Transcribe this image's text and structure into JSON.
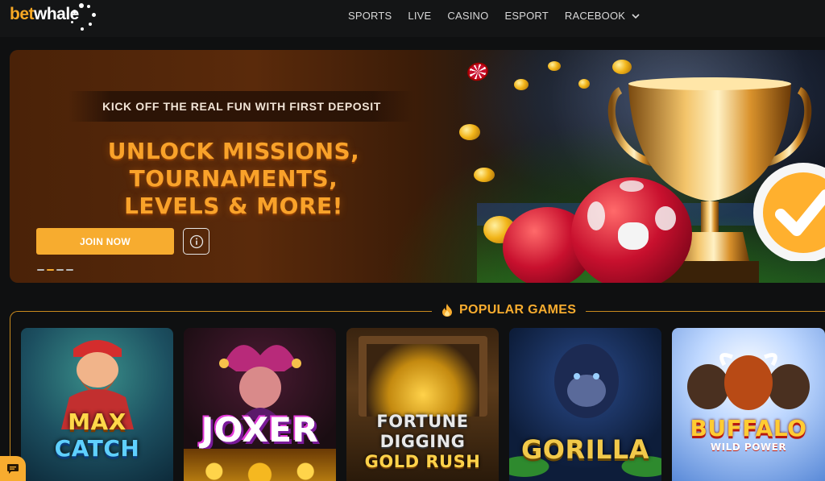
{
  "header": {
    "logo_part1": "bet",
    "logo_part2": "whale",
    "nav": [
      {
        "label": "SPORTS"
      },
      {
        "label": "LIVE"
      },
      {
        "label": "CASINO"
      },
      {
        "label": "ESPORT"
      },
      {
        "label": "RACEBOOK",
        "icon": "chevron-down-icon"
      }
    ]
  },
  "hero": {
    "tagline": "KICK OFF THE REAL FUN WITH FIRST DEPOSIT",
    "headline_line1": "UNLOCK MISSIONS, TOURNAMENTS,",
    "headline_line2": "LEVELS & MORE!",
    "cta_label": "JOIN NOW",
    "info_icon": "info-icon",
    "slides_total": 4,
    "active_slide": 2
  },
  "popular": {
    "title": "POPULAR GAMES",
    "icon": "fire-icon",
    "games": [
      {
        "title_line1": "MAX",
        "title_line2": "CATCH"
      },
      {
        "title_line1": "JOXER"
      },
      {
        "title_line1": "FORTUNE",
        "title_line2": "DIGGING",
        "title_line3": "GOLD RUSH"
      },
      {
        "title_line1": "GORILLA"
      },
      {
        "title_line1": "BUFFALO",
        "title_line2": "WILD POWER"
      }
    ]
  },
  "colors": {
    "accent": "#f7ac2f",
    "background": "#0f1011",
    "header_bg": "#141516"
  },
  "chat_icon": "chat-icon"
}
